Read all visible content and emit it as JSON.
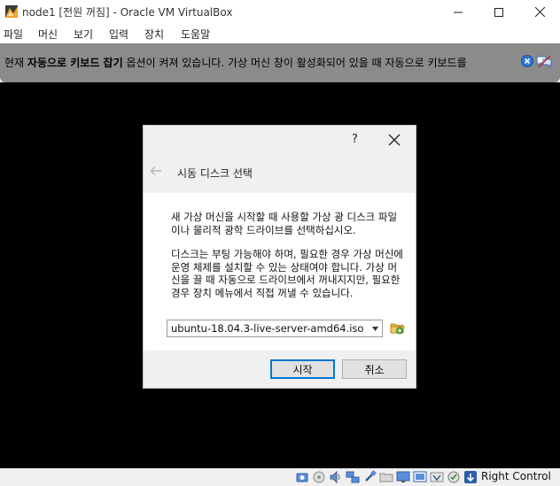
{
  "window": {
    "title": "node1 [전원 꺼짐] - Oracle VM VirtualBox",
    "app_icon": "virtualbox-icon",
    "controls": [
      "minimize-icon",
      "maximize-icon",
      "close-icon"
    ]
  },
  "menu": {
    "items": [
      {
        "label": "파일"
      },
      {
        "label": "머신"
      },
      {
        "label": "보기"
      },
      {
        "label": "입력"
      },
      {
        "label": "장치"
      },
      {
        "label": "도움말"
      }
    ]
  },
  "notification": {
    "pre": "현재 ",
    "bold": "자동으로 키보드 잡기",
    "post": " 옵션이 켜져 있습니다. 가상 머신 창이 활성화되어 있을 때 자동으로 키보드를",
    "close_icon": "close-circle-icon",
    "disable_icon": "do-not-show-again-icon"
  },
  "dialog": {
    "help": "?",
    "heading": "시동 디스크 선택",
    "paragraph1": "새 가상 머신을 시작할 때 사용할 가상 광 디스크 파일이나 물리적 광학 드라이브를 선택하십시오.",
    "paragraph2": "디스크는 부팅 가능해야 하며, 필요한 경우 가상 머신에 운영 체제를 설치할 수 있는 상태여야 합니다. 가상 머신을 끌 때 자동으로 드라이브에서 꺼내지지만, 필요한 경우 장치 메뉴에서 직접 꺼낼 수 있습니다.",
    "disk_select": {
      "value": "ubuntu-18.04.3-live-server-amd64.iso"
    },
    "buttons": {
      "start": "시작",
      "cancel": "취소"
    }
  },
  "statusbar": {
    "icons": [
      "hard-disk-icon",
      "optical-drive-icon",
      "audio-icon",
      "network-icon",
      "usb-icon",
      "shared-folders-icon",
      "display-icon",
      "screen-capture-icon",
      "recording-icon",
      "cpu-icon",
      "mouse-integration-icon",
      "host-key-arrow-icon"
    ],
    "host_key": "Right Control"
  },
  "colors": {
    "accent": "#0078d7",
    "notification_bg": "#8b8b8b",
    "vm_screen": "#000000"
  }
}
